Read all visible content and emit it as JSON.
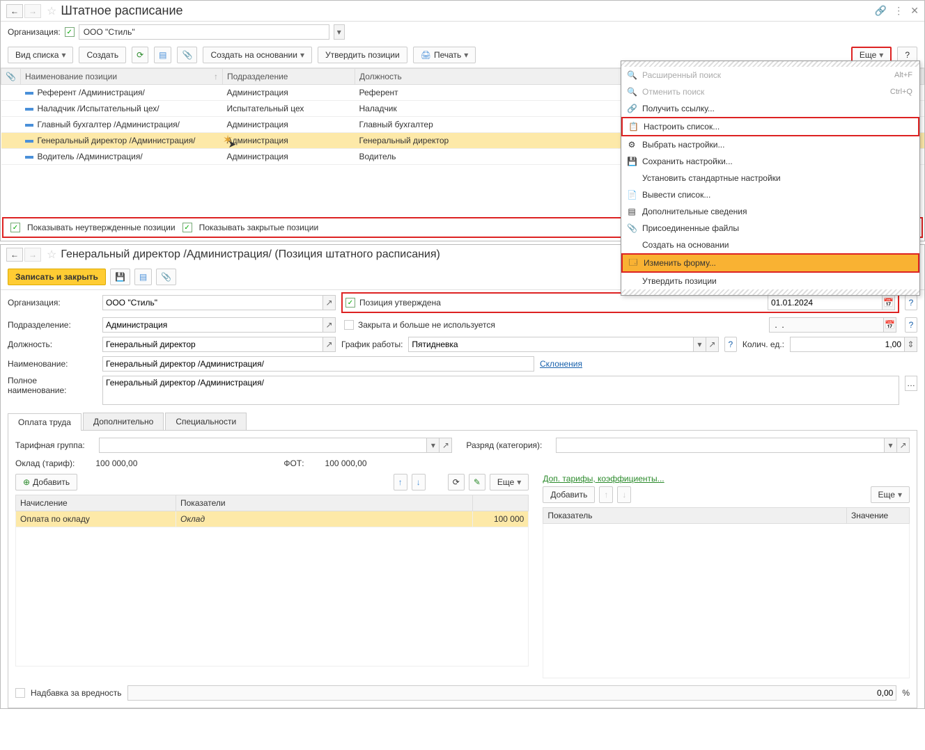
{
  "top": {
    "title": "Штатное расписание",
    "org_label": "Организация:",
    "org_value": "ООО \"Стиль\""
  },
  "toolbar": {
    "list_type": "Вид списка",
    "create": "Создать",
    "create_based": "Создать на основании",
    "approve": "Утвердить позиции",
    "print": "Печать",
    "more": "Еще",
    "help": "?"
  },
  "columns": {
    "attach": " ",
    "name": "Наименование позиции",
    "dept": "Подразделение",
    "position": "Должность"
  },
  "rows": [
    {
      "name": "Референт /Администрация/",
      "dept": "Администрация",
      "pos": "Референт"
    },
    {
      "name": "Наладчик /Испытательный цех/",
      "dept": "Испытательный цех",
      "pos": "Наладчик"
    },
    {
      "name": "Главный бухгалтер /Администрация/",
      "dept": "Администрация",
      "pos": "Главный бухгалтер"
    },
    {
      "name": "Генеральный директор /Администрация/",
      "dept": "Администрация",
      "pos": "Генеральный директор"
    },
    {
      "name": "Водитель /Администрация/",
      "dept": "Администрация",
      "pos": "Водитель"
    }
  ],
  "chk1": "Показывать неутвержденные позиции",
  "chk2": "Показывать закрытые позиции",
  "menu": {
    "adv_search": "Расширенный поиск",
    "adv_sc": "Alt+F",
    "cancel_search": "Отменить поиск",
    "cancel_sc": "Ctrl+Q",
    "get_link": "Получить ссылку...",
    "config_list": "Настроить список...",
    "choose_settings": "Выбрать настройки...",
    "save_settings": "Сохранить настройки...",
    "std_settings": "Установить стандартные настройки",
    "output_list": "Вывести список...",
    "extra_info": "Дополнительные сведения",
    "attached": "Присоединенные файлы",
    "create_based": "Создать на основании",
    "change_form": "Изменить форму...",
    "approve": "Утвердить позиции"
  },
  "detail": {
    "title": "Генеральный директор /Администрация/ (Позиция штатного расписания)",
    "save_close": "Записать и закрыть",
    "org_label": "Организация:",
    "org_value": "ООО \"Стиль\"",
    "dept_label": "Подразделение:",
    "dept_value": "Администрация",
    "pos_label": "Должность:",
    "pos_value": "Генеральный директор",
    "name_label": "Наименование:",
    "name_value": "Генеральный директор /Администрация/",
    "fullname_label": "Полное наименование:",
    "fullname_value": "Генеральный директор /Администрация/",
    "declension": "Склонения",
    "approved": "Позиция утверждена",
    "approved_date": "01.01.2024",
    "closed": "Закрыта и больше не используется",
    "closed_date": " .  .  ",
    "sched_label": "График работы:",
    "sched_value": "Пятидневка",
    "units_label": "Колич. ед.:",
    "units_value": "1,00"
  },
  "tabs": {
    "pay": "Оплата труда",
    "extra": "Дополнительно",
    "spec": "Специальности"
  },
  "pay": {
    "tariff_group_label": "Тарифная группа:",
    "rank_label": "Разряд (категория):",
    "salary_label": "Оклад (тариф):",
    "salary_value": "100 000,00",
    "fot_label": "ФОТ:",
    "fot_value": "100 000,00",
    "add": "Добавить",
    "more": "Еще",
    "col_accrual": "Начисление",
    "col_indicators": "Показатели",
    "row_accrual": "Оплата по окладу",
    "row_indicator": "Оклад",
    "row_val": "100 000",
    "extra_coef": "Доп. тарифы, коэффициенты...",
    "add2": "Добавить",
    "more2": "Еще",
    "col_ind": "Показатель",
    "col_val": "Значение",
    "harm_label": "Надбавка за вредность",
    "harm_value": "0,00",
    "harm_pct": "%"
  }
}
